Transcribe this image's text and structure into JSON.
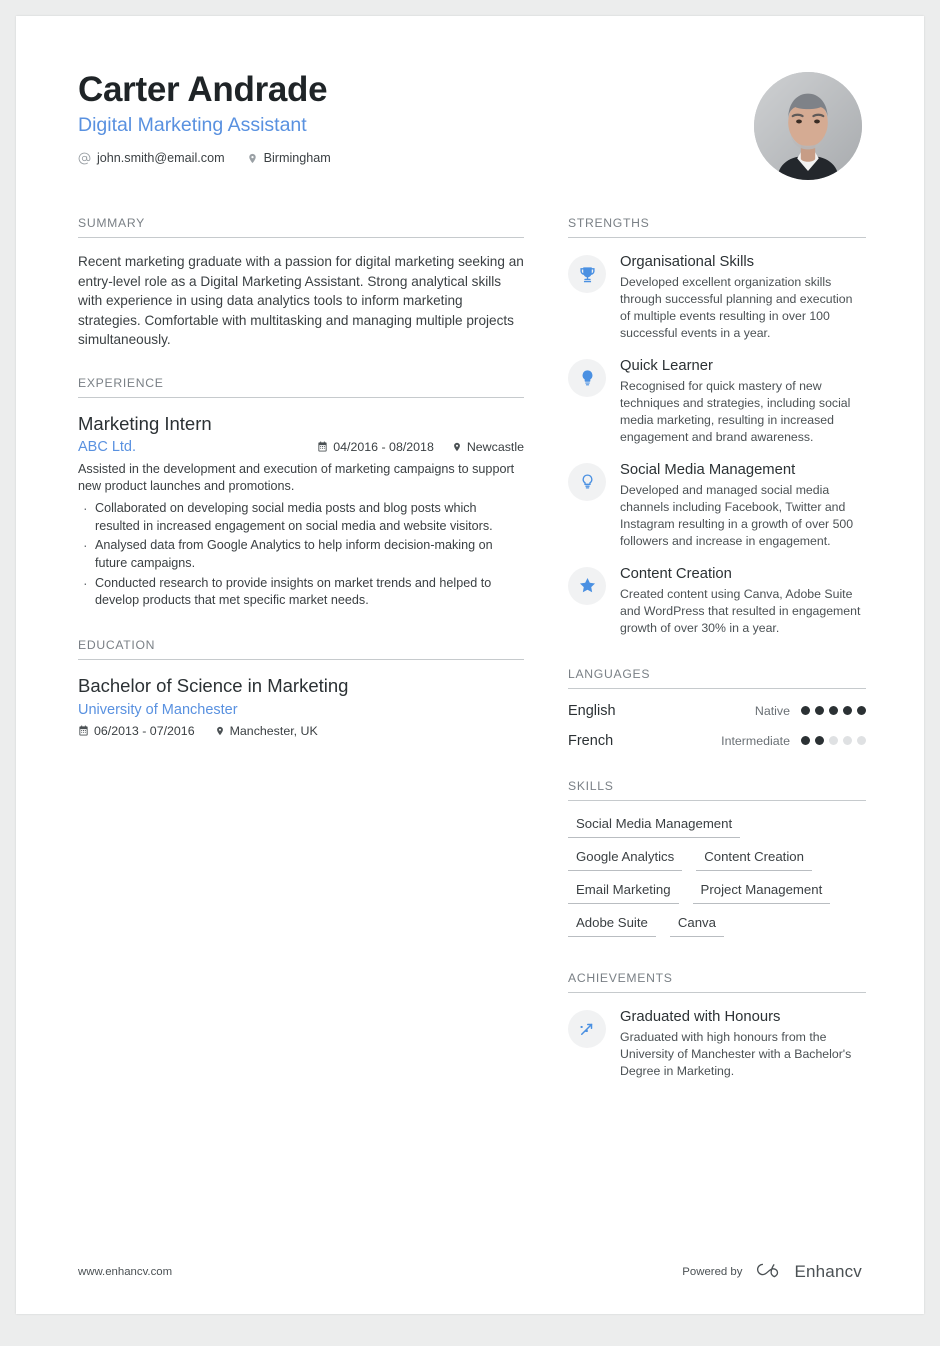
{
  "header": {
    "name": "Carter Andrade",
    "role": "Digital Marketing Assistant",
    "email": "john.smith@email.com",
    "location": "Birmingham",
    "email_icon": "at-icon",
    "location_icon": "location-pin-icon",
    "avatar_alt": "profile-photo"
  },
  "accent_color": "#5991e0",
  "sections": {
    "summary_title": "SUMMARY",
    "experience_title": "EXPERIENCE",
    "education_title": "EDUCATION",
    "strengths_title": "STRENGTHS",
    "languages_title": "LANGUAGES",
    "skills_title": "SKILLS",
    "achievements_title": "ACHIEVEMENTS"
  },
  "summary": {
    "text": "Recent marketing graduate with a passion for digital marketing seeking an entry-level role as a Digital Marketing Assistant. Strong analytical skills with experience in using data analytics tools to inform marketing strategies. Comfortable with multitasking and managing multiple projects simultaneously."
  },
  "experience": [
    {
      "title": "Marketing Intern",
      "organization": "ABC Ltd.",
      "dates": "04/2016 - 08/2018",
      "location": "Newcastle",
      "description": "Assisted in the development and execution of marketing campaigns to support new product launches and promotions.",
      "bullets": [
        "Collaborated on developing social media posts and blog posts which resulted in increased engagement on social media and website visitors.",
        "Analysed data from Google Analytics to help inform decision-making on future campaigns.",
        "Conducted research to provide insights on market trends and helped to develop products that met specific market needs."
      ]
    }
  ],
  "education": [
    {
      "degree": "Bachelor of Science in Marketing",
      "institution": "University of Manchester",
      "dates": "06/2013 - 07/2016",
      "location": "Manchester, UK"
    }
  ],
  "strengths": [
    {
      "icon": "trophy-icon",
      "title": "Organisational Skills",
      "description": "Developed excellent organization skills through successful planning and execution of multiple events resulting in over 100 successful events in a year."
    },
    {
      "icon": "lightbulb-icon",
      "title": "Quick Learner",
      "description": "Recognised for quick mastery of new techniques and strategies, including social media marketing, resulting in increased engagement and brand awareness."
    },
    {
      "icon": "lightbulb-outline-icon",
      "title": "Social Media Management",
      "description": "Developed and managed social media channels including Facebook, Twitter and Instagram resulting in a growth of over 500 followers and increase in engagement."
    },
    {
      "icon": "star-icon",
      "title": "Content Creation",
      "description": "Created content using Canva, Adobe Suite and WordPress that resulted in engagement growth of over 30% in a year."
    }
  ],
  "languages": [
    {
      "name": "English",
      "level": "Native",
      "rating": 5,
      "max": 5
    },
    {
      "name": "French",
      "level": "Intermediate",
      "rating": 2,
      "max": 5
    }
  ],
  "skills": [
    "Social Media Management",
    "Google Analytics",
    "Content Creation",
    "Email Marketing",
    "Project Management",
    "Adobe Suite",
    "Canva"
  ],
  "achievements": [
    {
      "icon": "trending-arrow-icon",
      "title": "Graduated with Honours",
      "description": "Graduated with high honours from the University of Manchester with a Bachelor's Degree in Marketing."
    }
  ],
  "footer": {
    "url": "www.enhancv.com",
    "powered_by": "Powered by",
    "brand": "Enhancv",
    "brand_icon": "enhancv-logo-icon"
  }
}
